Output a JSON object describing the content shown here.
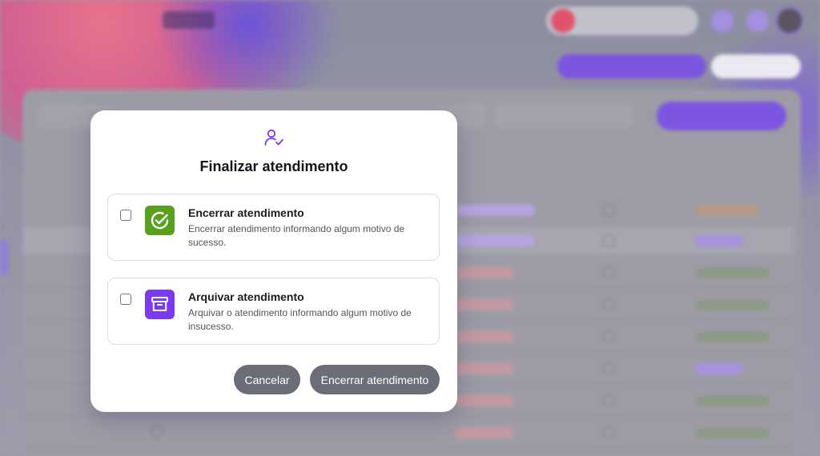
{
  "modal": {
    "title": "Finalizar atendimento",
    "options": [
      {
        "title": "Encerrar atendimento",
        "description": "Encerrar atendimento informando algum motivo de sucesso.",
        "icon": "check-circle-icon",
        "color": "#5aa01e",
        "checked": false
      },
      {
        "title": "Arquivar atendimento",
        "description": "Arquivar o atendimento informando algum motivo de insucesso.",
        "icon": "archive-icon",
        "color": "#7c3aed",
        "checked": false
      }
    ],
    "cancel_label": "Cancelar",
    "confirm_label": "Encerrar atendimento",
    "header_icon": "user-check-icon",
    "accent": "#7c3aed"
  },
  "colors": {
    "button_gray": "#6b6e78",
    "overlay": "#9a9aa6"
  }
}
